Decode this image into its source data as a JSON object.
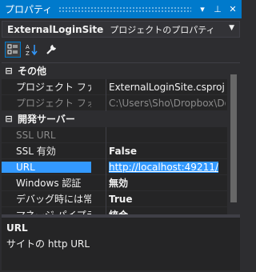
{
  "window": {
    "title": "プロパティ",
    "buttons": {
      "dropdown": "▾",
      "pin": "⊥",
      "close": "✕"
    }
  },
  "object_selector": {
    "name": "ExternalLoginSite",
    "type": "プロジェクトのプロパティ"
  },
  "toolbar": {
    "items": [
      "categorized-icon",
      "alphabetical-icon",
      "property-pages-icon"
    ]
  },
  "grid": {
    "categories": [
      {
        "label": "その他",
        "expanded": true,
        "properties": [
          {
            "name": "プロジェクト ファイル",
            "value": "ExternalLoginSite.csproj"
          },
          {
            "name": "プロジェクト フォルダー",
            "value": "C:\\Users\\Sho\\Dropbox\\Doc"
          }
        ]
      },
      {
        "label": "開発サーバー",
        "expanded": true,
        "properties": [
          {
            "name": "SSL URL",
            "value": ""
          },
          {
            "name": "SSL 有効",
            "value": "False"
          },
          {
            "name": "URL",
            "value": "http://localhost:49211/"
          },
          {
            "name": "Windows 認証",
            "value": "無効"
          },
          {
            "name": "デバッグ時には常に起動",
            "value": "True"
          },
          {
            "name": "マネージ パイプライン モード",
            "value": "統合"
          }
        ]
      }
    ],
    "toggle_symbol": "⊟"
  },
  "description": {
    "title": "URL",
    "text": "サイトの http URL"
  },
  "colors": {
    "accent": "#007acc",
    "selection": "#3399ff",
    "background": "#2d2d30"
  }
}
